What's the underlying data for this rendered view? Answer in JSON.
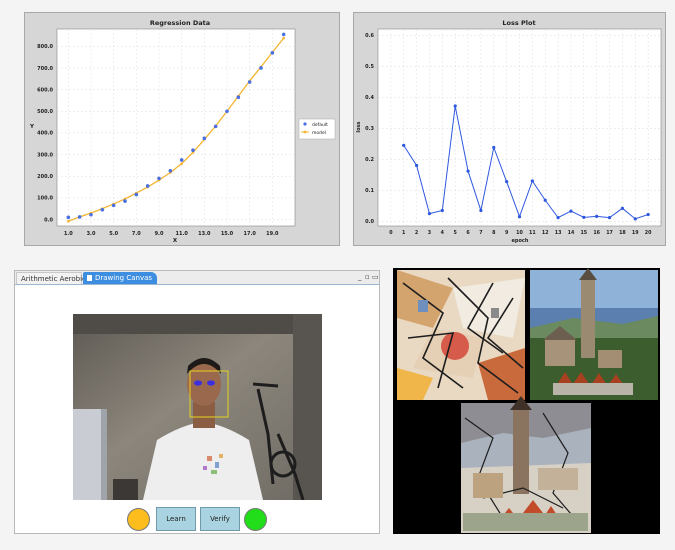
{
  "regression_panel": {
    "chart_data": {
      "type": "scatter",
      "title": "Regression Data",
      "xlabel": "X",
      "ylabel": "Y",
      "xlim": [
        0,
        21
      ],
      "ylim": [
        -30,
        880
      ],
      "xticks": [
        "1.0",
        "3.0",
        "5.0",
        "7.0",
        "9.0",
        "11.0",
        "13.0",
        "15.0",
        "17.0",
        "19.0"
      ],
      "yticks": [
        "0.0",
        "100.0",
        "200.0",
        "300.0",
        "400.0",
        "500.0",
        "600.0",
        "700.0",
        "800.0"
      ],
      "grid": true,
      "legend_position": "right",
      "series": [
        {
          "name": "default",
          "kind": "scatter",
          "color": "#4a6fe0",
          "x": [
            1,
            2,
            3,
            4,
            5,
            6,
            7,
            8,
            9,
            10,
            11,
            12,
            13,
            14,
            15,
            16,
            17,
            18,
            19,
            20
          ],
          "y": [
            10,
            12,
            22,
            45,
            65,
            85,
            115,
            155,
            190,
            225,
            275,
            320,
            375,
            430,
            500,
            565,
            635,
            700,
            770,
            855
          ]
        },
        {
          "name": "model",
          "kind": "line",
          "color": "#f4b430",
          "x": [
            1,
            2,
            3,
            4,
            5,
            6,
            7,
            8,
            9,
            10,
            11,
            12,
            13,
            14,
            15,
            16,
            17,
            18,
            19,
            20
          ],
          "y": [
            -8,
            12,
            30,
            50,
            72,
            95,
            122,
            150,
            182,
            217,
            258,
            310,
            370,
            432,
            500,
            570,
            640,
            705,
            772,
            838
          ]
        }
      ]
    }
  },
  "loss_panel": {
    "chart_data": {
      "type": "line",
      "title": "Loss Plot",
      "xlabel": "epoch",
      "ylabel": "loss",
      "xlim": [
        -1,
        21
      ],
      "ylim": [
        -0.015,
        0.62
      ],
      "xticks": [
        "0",
        "1",
        "2",
        "3",
        "4",
        "5",
        "6",
        "7",
        "8",
        "9",
        "10",
        "11",
        "12",
        "13",
        "14",
        "15",
        "16",
        "17",
        "18",
        "19",
        "20"
      ],
      "yticks": [
        "0.0",
        "0.1",
        "0.2",
        "0.3",
        "0.4",
        "0.5",
        "0.6"
      ],
      "grid": true,
      "series": [
        {
          "color": "#2f58e0",
          "x": [
            1,
            2,
            3,
            4,
            5,
            6,
            7,
            8,
            9,
            10,
            11,
            12,
            13,
            14,
            15,
            16,
            17,
            18,
            19,
            20
          ],
          "y": [
            0.245,
            0.18,
            0.025,
            0.035,
            0.372,
            0.162,
            0.035,
            0.238,
            0.128,
            0.015,
            0.13,
            0.068,
            0.012,
            0.033,
            0.013,
            0.016,
            0.012,
            0.042,
            0.008,
            0.022
          ]
        }
      ]
    }
  },
  "app": {
    "tabs": [
      {
        "label": "Arithmetic Aerobics"
      },
      {
        "label": "Drawing Canvas"
      }
    ],
    "active_tab": "Drawing Canvas",
    "window_controls": {
      "minimize": "_",
      "maximize": "▫",
      "restore": "▭"
    },
    "buttons": {
      "learn": "Learn",
      "verify": "Verify"
    },
    "status_colors": {
      "left": "#fdbd1c",
      "right": "#22dd1a"
    },
    "face_box_color": "#e6d21e"
  },
  "style_transfer": {
    "images": [
      {
        "name": "style-artwork"
      },
      {
        "name": "content-photo"
      },
      {
        "name": "stylized-output"
      }
    ]
  }
}
